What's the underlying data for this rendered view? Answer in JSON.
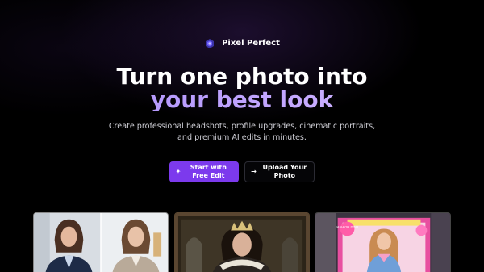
{
  "brand": {
    "name": "Pixel Perfect",
    "logo_icon": "camera-icon",
    "logo_color": "#6d5dfc"
  },
  "hero": {
    "headline_line1": "Turn one photo into",
    "headline_line2": "your best look",
    "subtitle": "Create professional headshots, profile upgrades, cinematic portraits, and premium AI edits in minutes."
  },
  "cta": {
    "primary_label": "Start with Free Edit",
    "primary_icon": "sparkle-icon",
    "secondary_label": "Upload Your Photo",
    "secondary_icon": "arrow-right-icon"
  },
  "colors": {
    "accent": "#7c3aed",
    "gradient_text": "#a78bfa",
    "background": "#000000"
  },
  "gallery": {
    "items": [
      {
        "kind": "before-after-headshot"
      },
      {
        "kind": "royal-portrait"
      },
      {
        "kind": "fashion-doll-box",
        "box_text": "FASHION DOLL"
      }
    ]
  }
}
